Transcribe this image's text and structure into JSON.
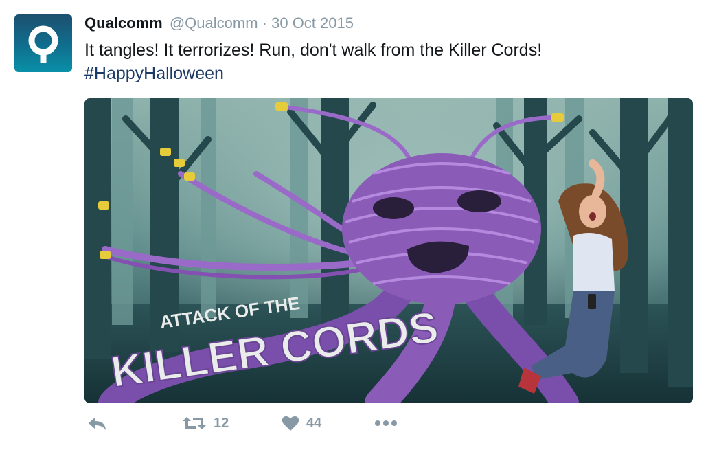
{
  "tweet": {
    "author_name": "Qualcomm",
    "handle": "@Qualcomm",
    "separator": "·",
    "date": "30 Oct 2015",
    "text": "It tangles! It terrorizes! Run, don't walk from the Killer Cords!",
    "hashtag": "#HappyHalloween"
  },
  "media": {
    "line1": "ATTACK OF THE",
    "line2": "KILLER CORDS"
  },
  "actions": {
    "reply_icon": "reply-icon",
    "retweet_icon": "retweet-icon",
    "retweet_count": "12",
    "like_icon": "heart-icon",
    "like_count": "44",
    "more_icon": "more-icon"
  },
  "colors": {
    "avatar_bg": "#0f6f8e",
    "meta_gray": "#8899a6",
    "hashtag": "#1b3a66",
    "monster_purple": "#8a5cb8"
  }
}
